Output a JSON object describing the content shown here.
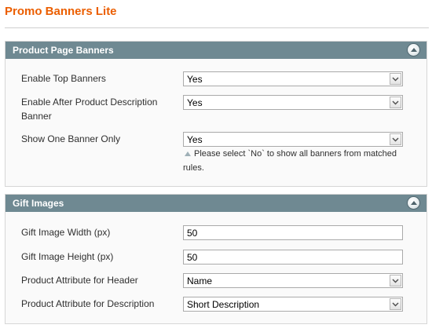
{
  "page_title": "Promo Banners Lite",
  "sections": [
    {
      "title": "Product Page Banners",
      "fields": [
        {
          "label": "Enable Top Banners",
          "type": "select",
          "value": "Yes"
        },
        {
          "label": "Enable After Product Description Banner",
          "type": "select",
          "value": "Yes"
        },
        {
          "label": "Show One Banner Only",
          "type": "select",
          "value": "Yes",
          "note": "Please select `No` to show all banners from matched rules."
        }
      ]
    },
    {
      "title": "Gift Images",
      "fields": [
        {
          "label": "Gift Image Width (px)",
          "type": "text",
          "value": "50"
        },
        {
          "label": "Gift Image Height (px)",
          "type": "text",
          "value": "50"
        },
        {
          "label": "Product Attribute for Header",
          "type": "select",
          "value": "Name"
        },
        {
          "label": "Product Attribute for Description",
          "type": "select",
          "value": "Short Description"
        }
      ]
    }
  ],
  "icons": {
    "collapse": "collapse-up-icon",
    "dropdown": "chevron-down-icon",
    "note": "note-triangle-icon"
  },
  "colors": {
    "title": "#eb5e00",
    "section_header": "#6f8992"
  }
}
